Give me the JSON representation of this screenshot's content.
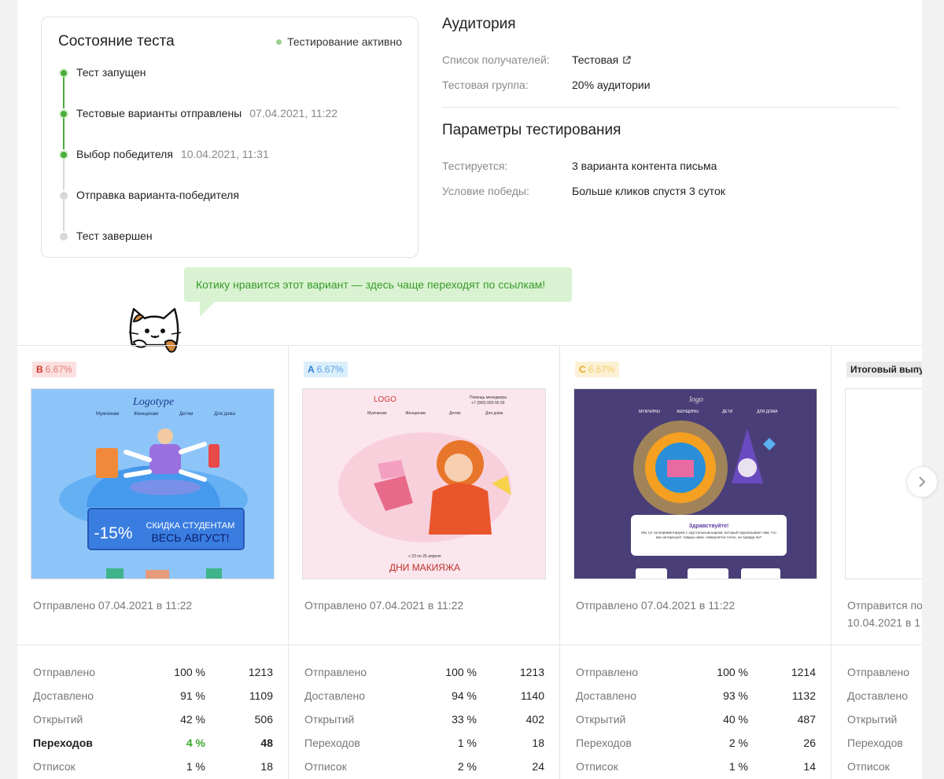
{
  "status": {
    "title": "Состояние теста",
    "active_label": "Тестирование активно",
    "steps": [
      {
        "label": "Тест запущен",
        "date": "",
        "done": true
      },
      {
        "label": "Тестовые варианты отправлены",
        "date": "07.04.2021, 11:22",
        "done": true
      },
      {
        "label": "Выбор победителя",
        "date": "10.04.2021, 11:31",
        "done": true
      },
      {
        "label": "Отправка варианта-победителя",
        "date": "",
        "done": false
      },
      {
        "label": "Тест завершен",
        "date": "",
        "done": false
      }
    ]
  },
  "audience": {
    "title": "Аудитория",
    "recipients_label": "Список получателей:",
    "recipients_value": "Тестовая",
    "group_label": "Тестовая группа:",
    "group_value": "20% аудитории"
  },
  "params": {
    "title": "Параметры тестирования",
    "tested_label": "Тестируется:",
    "tested_value": "3 варианта контента письма",
    "win_label": "Условие победы:",
    "win_value": "Больше кликов спустя 3 суток"
  },
  "tooltip": "Котику нравится этот вариант — здесь чаще переходят по ссылкам!",
  "variants": [
    {
      "letter": "B",
      "share": "6.67%",
      "badge_bg": "#fbe0df",
      "letter_color": "#d0342c",
      "share_color": "#e17c76",
      "sent": "Отправлено 07.04.2021 в 11:22",
      "thumb_logo": "Logotype",
      "thumb_nav": [
        "Мужчинам",
        "Женщинам",
        "Детям",
        "Для дома"
      ],
      "thumb_discount": "-15%",
      "thumb_line1": "СКИДКА СТУДЕНТАМ",
      "thumb_line2": "ВЕСЬ АВГУСТ!",
      "stats": [
        {
          "name": "Отправлено",
          "pct": "100 %",
          "num": "1213"
        },
        {
          "name": "Доставлено",
          "pct": "91 %",
          "num": "1109"
        },
        {
          "name": "Открытий",
          "pct": "42 %",
          "num": "506"
        },
        {
          "name": "Переходов",
          "pct": "4 %",
          "num": "48"
        },
        {
          "name": "Отписок",
          "pct": "1 %",
          "num": "18"
        }
      ]
    },
    {
      "letter": "A",
      "share": "6.67%",
      "badge_bg": "#dbeefc",
      "letter_color": "#2f7fd0",
      "share_color": "#5fa3e0",
      "sent": "Отправлено 07.04.2021 в 11:22",
      "thumb_logo": "LOGO",
      "thumb_help": "Помощь менеджера",
      "thumb_phone": "+7 (000) 000 00 00",
      "thumb_nav": [
        "Мужчинам",
        "Женщинам",
        "Детям",
        "Для дома"
      ],
      "thumb_dates": "с 23 по 26 апреля",
      "thumb_headline": "ДНИ МАКИЯЖА",
      "stats": [
        {
          "name": "Отправлено",
          "pct": "100 %",
          "num": "1213"
        },
        {
          "name": "Доставлено",
          "pct": "94 %",
          "num": "1140"
        },
        {
          "name": "Открытий",
          "pct": "33 %",
          "num": "402"
        },
        {
          "name": "Переходов",
          "pct": "1 %",
          "num": "18"
        },
        {
          "name": "Отписок",
          "pct": "2 %",
          "num": "24"
        }
      ]
    },
    {
      "letter": "C",
      "share": "6.67%",
      "badge_bg": "#fdf1d5",
      "letter_color": "#e8a81a",
      "share_color": "#f1c968",
      "sent": "Отправлено 07.04.2021 в 11:22",
      "thumb_logo": "logo",
      "thumb_nav": [
        "МУЖЧИНЫ",
        "ЖЕНЩИНЫ",
        "ДЕТИ",
        "ДЛЯ ДОМА"
      ],
      "thumb_greeting": "Здравствуйте!",
      "thumb_body": "Мы тут экспериментируем с хрустальным шаром, который подсказывает нам, что вас интересуют товары ниже. Невероятно точно, не правда ли?",
      "stats": [
        {
          "name": "Отправлено",
          "pct": "100 %",
          "num": "1214"
        },
        {
          "name": "Доставлено",
          "pct": "93 %",
          "num": "1132"
        },
        {
          "name": "Открытий",
          "pct": "40 %",
          "num": "487"
        },
        {
          "name": "Переходов",
          "pct": "2 %",
          "num": "26"
        },
        {
          "name": "Отписок",
          "pct": "1 %",
          "num": "14"
        }
      ]
    },
    {
      "badge": "Итоговый выпу",
      "sent_line1": "Отправится по",
      "sent_line2": "10.04.2021 в 1",
      "stats": [
        {
          "name": "Отправлено"
        },
        {
          "name": "Доставлено"
        },
        {
          "name": "Открытий"
        },
        {
          "name": "Переходов"
        },
        {
          "name": "Отписок"
        }
      ]
    }
  ]
}
